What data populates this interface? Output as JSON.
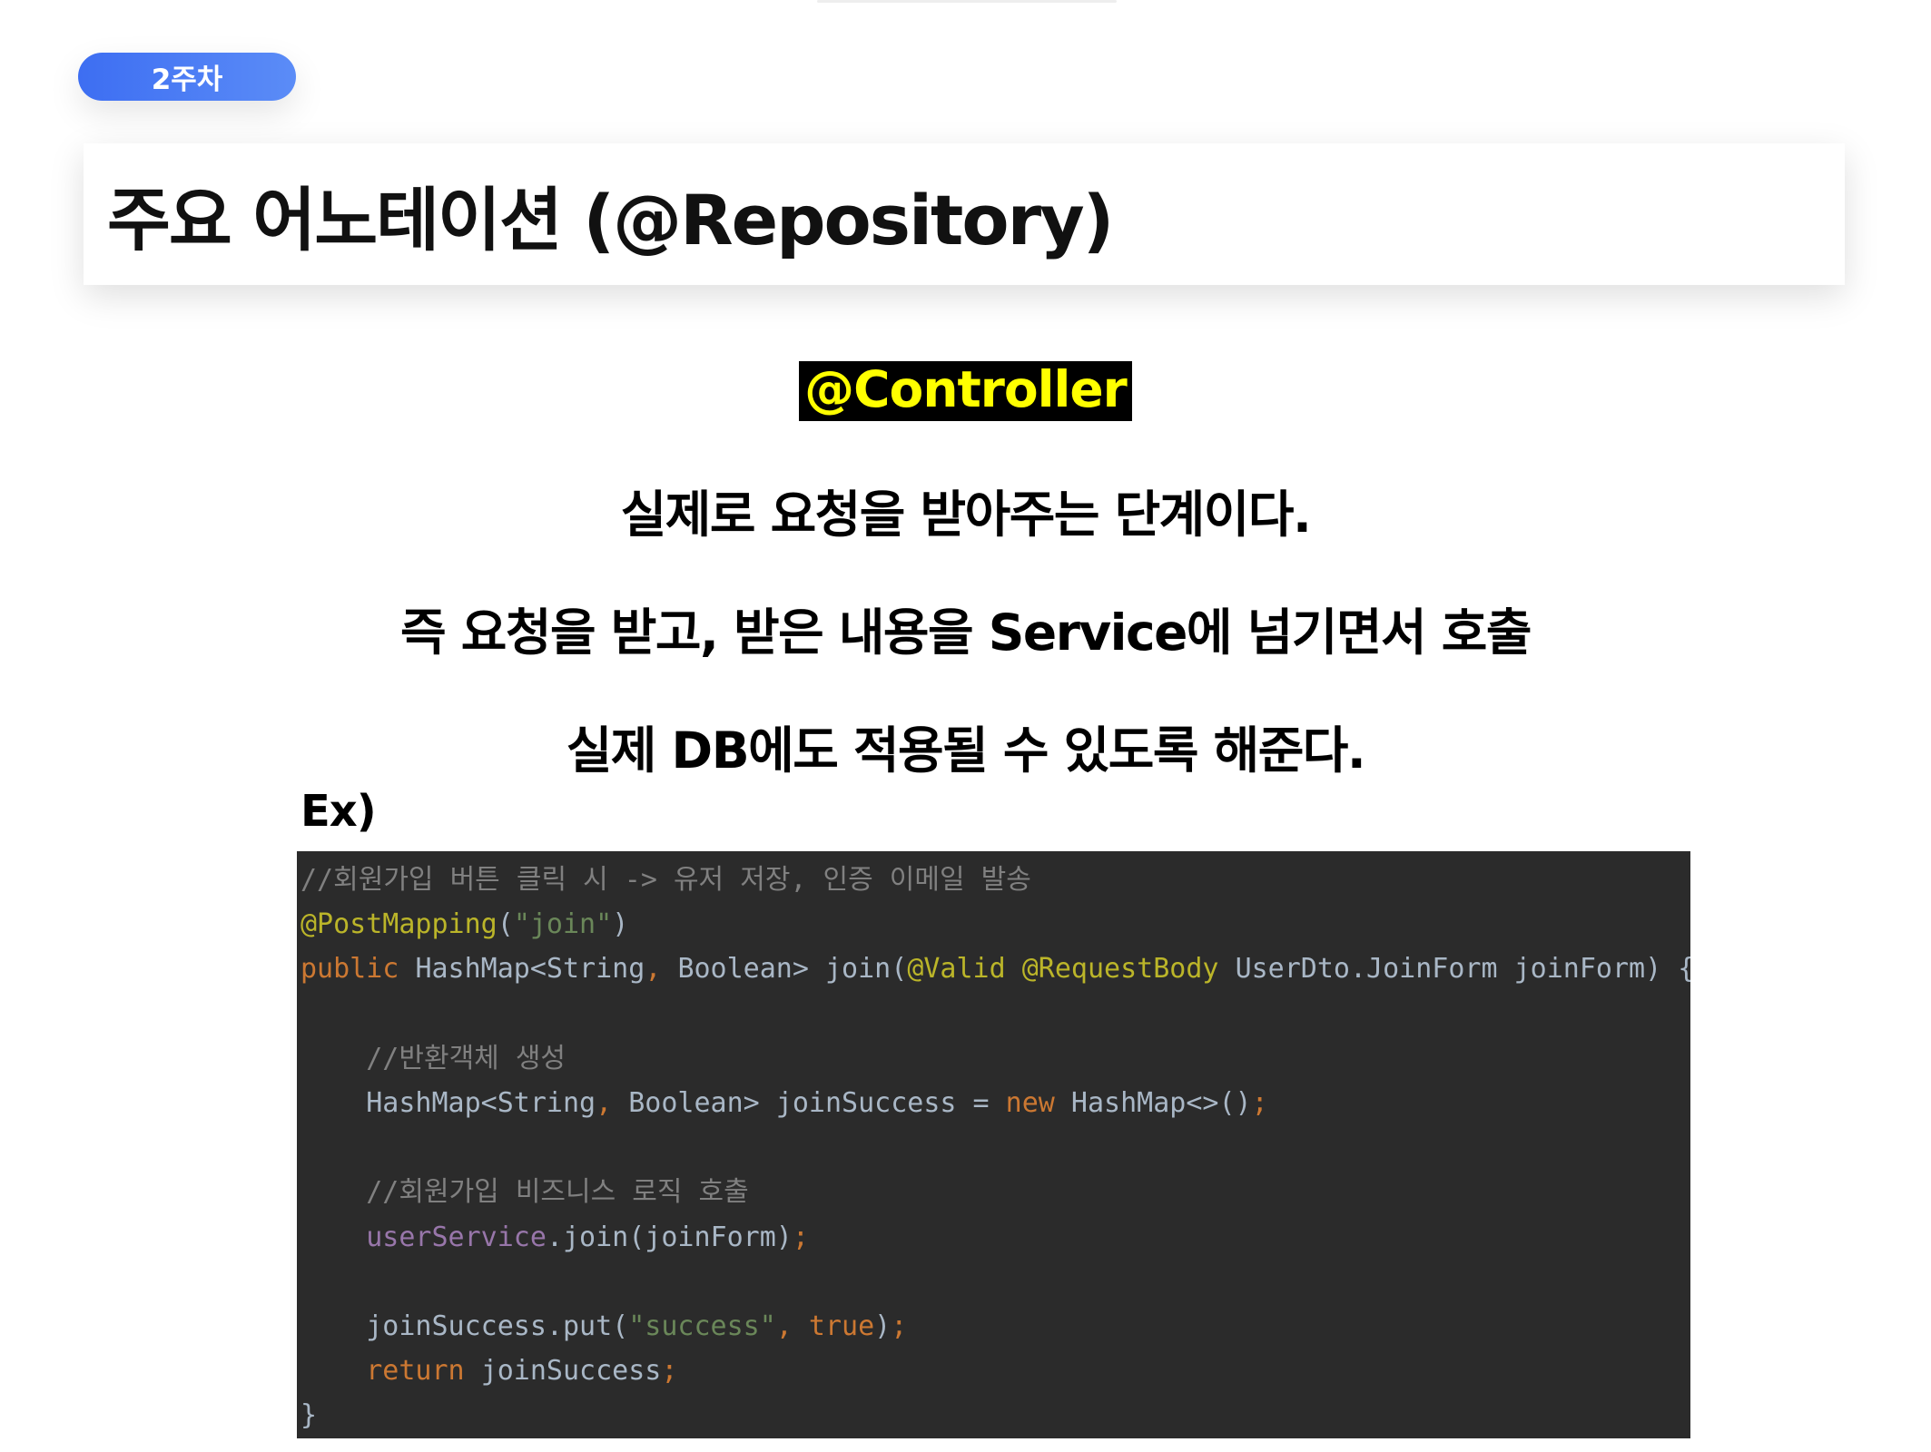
{
  "badge": {
    "label": "2주차"
  },
  "header": {
    "title": "주요 어노테이션 (@Repository)"
  },
  "content": {
    "highlight": "@Controller",
    "lines": [
      "실제로 요청을 받아주는 단계이다.",
      "즉 요청을 받고, 받은 내용을 Service에 넘기면서 호출",
      "실제 DB에도 적용될 수 있도록 해준다."
    ],
    "example_label": "Ex)"
  },
  "code": {
    "lines": [
      [
        {
          "t": "//회원가입 버튼 클릭 시 -> 유저 저장, 인증 이메일 발송",
          "c": "comment"
        }
      ],
      [
        {
          "t": "@PostMapping",
          "c": "annot"
        },
        {
          "t": "(",
          "c": "text"
        },
        {
          "t": "\"join\"",
          "c": "str"
        },
        {
          "t": ")",
          "c": "text"
        }
      ],
      [
        {
          "t": "public ",
          "c": "kw"
        },
        {
          "t": "HashMap<String",
          "c": "text"
        },
        {
          "t": ", ",
          "c": "punct"
        },
        {
          "t": "Boolean> ",
          "c": "text"
        },
        {
          "t": "join",
          "c": "text"
        },
        {
          "t": "(",
          "c": "text"
        },
        {
          "t": "@Valid ",
          "c": "annot"
        },
        {
          "t": "@RequestBody ",
          "c": "annot"
        },
        {
          "t": "UserDto.JoinForm joinForm) {",
          "c": "text"
        }
      ],
      [],
      [
        {
          "t": "    ",
          "c": "text"
        },
        {
          "t": "//반환객체 생성",
          "c": "comment"
        }
      ],
      [
        {
          "t": "    HashMap<String",
          "c": "text"
        },
        {
          "t": ", ",
          "c": "punct"
        },
        {
          "t": "Boolean> joinSuccess = ",
          "c": "text"
        },
        {
          "t": "new ",
          "c": "kw"
        },
        {
          "t": "HashMap<>()",
          "c": "text"
        },
        {
          "t": ";",
          "c": "punct"
        }
      ],
      [],
      [
        {
          "t": "    ",
          "c": "text"
        },
        {
          "t": "//회원가입 비즈니스 로직 호출",
          "c": "comment"
        }
      ],
      [
        {
          "t": "    ",
          "c": "text"
        },
        {
          "t": "userService",
          "c": "field"
        },
        {
          "t": ".join(joinForm)",
          "c": "text"
        },
        {
          "t": ";",
          "c": "punct"
        }
      ],
      [],
      [
        {
          "t": "    joinSuccess.put(",
          "c": "text"
        },
        {
          "t": "\"success\"",
          "c": "str"
        },
        {
          "t": ", ",
          "c": "punct"
        },
        {
          "t": "true",
          "c": "kw"
        },
        {
          "t": ")",
          "c": "text"
        },
        {
          "t": ";",
          "c": "punct"
        }
      ],
      [
        {
          "t": "    ",
          "c": "text"
        },
        {
          "t": "return ",
          "c": "kw"
        },
        {
          "t": "joinSuccess",
          "c": "text"
        },
        {
          "t": ";",
          "c": "punct"
        }
      ],
      [
        {
          "t": "}",
          "c": "text"
        }
      ]
    ]
  },
  "colors": {
    "badge_blue": "#3d6ef2",
    "highlight_bg": "#000000",
    "highlight_fg": "#ffff00",
    "code_bg": "#2b2b2b"
  }
}
